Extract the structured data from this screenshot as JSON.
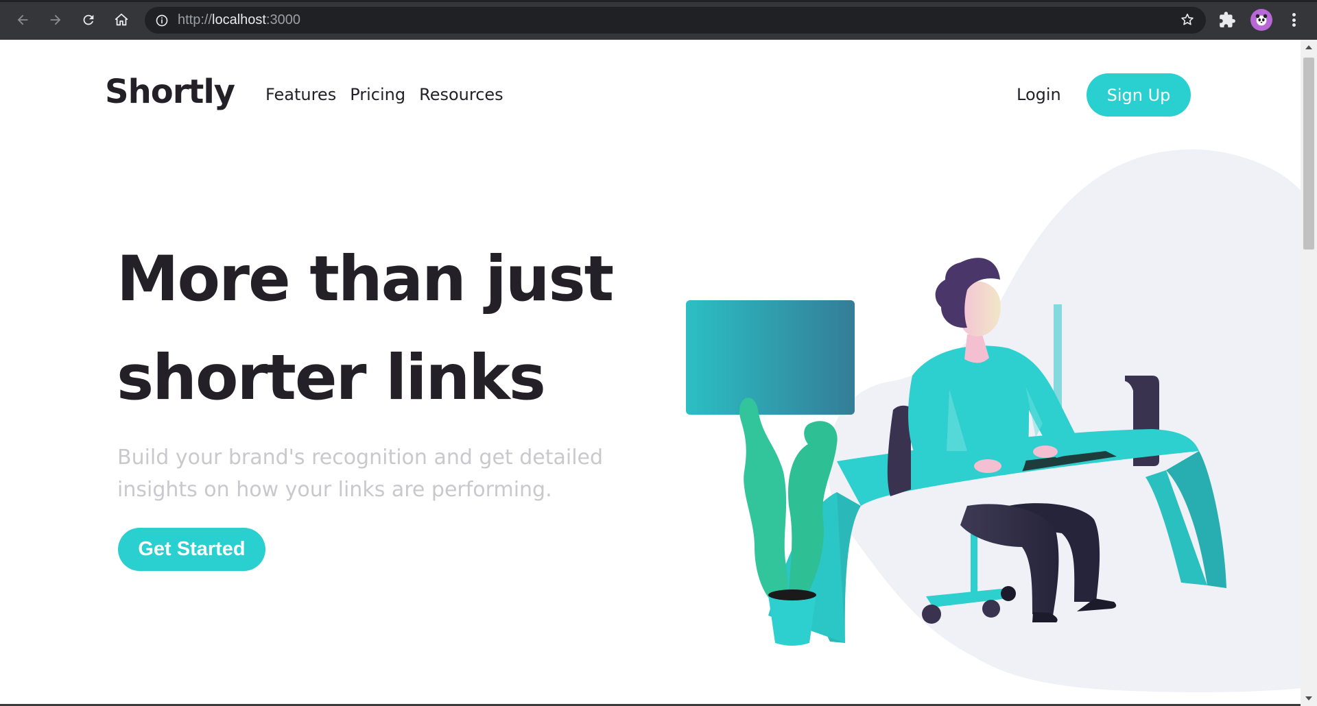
{
  "browser": {
    "url_scheme": "http://",
    "url_host": "localhost",
    "url_port": ":3000",
    "icons": [
      "back-icon",
      "forward-icon",
      "reload-icon",
      "home-icon",
      "info-icon",
      "bookmark-star-icon",
      "extensions-icon",
      "profile-avatar",
      "more-menu-icon"
    ]
  },
  "header": {
    "logo": "Shortly",
    "nav": [
      "Features",
      "Pricing",
      "Resources"
    ],
    "login": "Login",
    "signup": "Sign Up"
  },
  "hero": {
    "title_line1": "More than just",
    "title_line2": "shorter links",
    "subtitle_line1": "Build your brand's recognition and get detailed",
    "subtitle_line2": "insights on how your links are performing.",
    "cta": "Get Started"
  },
  "colors": {
    "brand": "#2acfcf",
    "text_dark": "#232127",
    "text_muted": "#c9c8cd",
    "chrome_bg": "#35363a"
  }
}
